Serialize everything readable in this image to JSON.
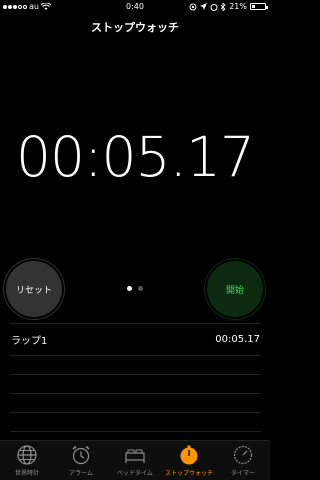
{
  "statusbar": {
    "carrier": "au",
    "time": "0:40",
    "battery": "21%",
    "battery_level": 0.21,
    "signal_dots": 5,
    "signal_filled": 3
  },
  "header": {
    "title": "ストップウォッチ"
  },
  "stopwatch": {
    "time": "00:05.17",
    "reset_label": "リセット",
    "start_label": "開始"
  },
  "laps": [
    {
      "label": "ラップ1",
      "time": "00:05.17"
    }
  ],
  "tabs": [
    {
      "label": "世界時計",
      "icon": "globe-icon",
      "active": false
    },
    {
      "label": "アラーム",
      "icon": "alarm-clock-icon",
      "active": false
    },
    {
      "label": "ベッドタイム",
      "icon": "bed-icon",
      "active": false
    },
    {
      "label": "ストップウォッチ",
      "icon": "stopwatch-icon",
      "active": true
    },
    {
      "label": "タイマー",
      "icon": "timer-icon",
      "active": false
    }
  ],
  "colors": {
    "accent": "#ff9500",
    "start_green": "#4cd964",
    "start_bg": "#0b2a10",
    "reset_bg": "#333333"
  }
}
